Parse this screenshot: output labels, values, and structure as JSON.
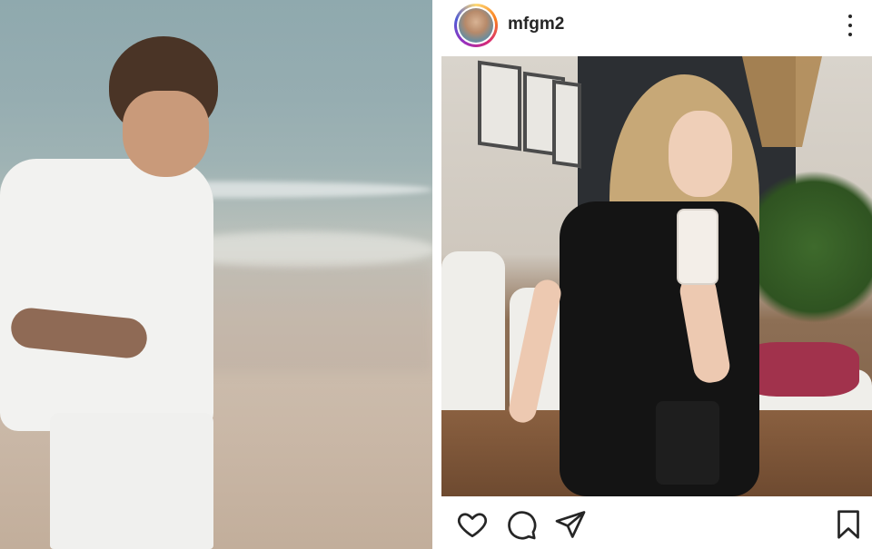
{
  "left_photo": {
    "icon": "beach-photo"
  },
  "post": {
    "username": "mfgm2",
    "avatar_icon": "profile-avatar",
    "more_icon": "more-options-icon",
    "image_icon": "post-photo",
    "actions": {
      "like_icon": "heart-icon",
      "comment_icon": "comment-icon",
      "share_icon": "send-icon",
      "save_icon": "bookmark-icon"
    }
  },
  "colors": {
    "text_primary": "#262626",
    "story_ring": "#d62976"
  }
}
